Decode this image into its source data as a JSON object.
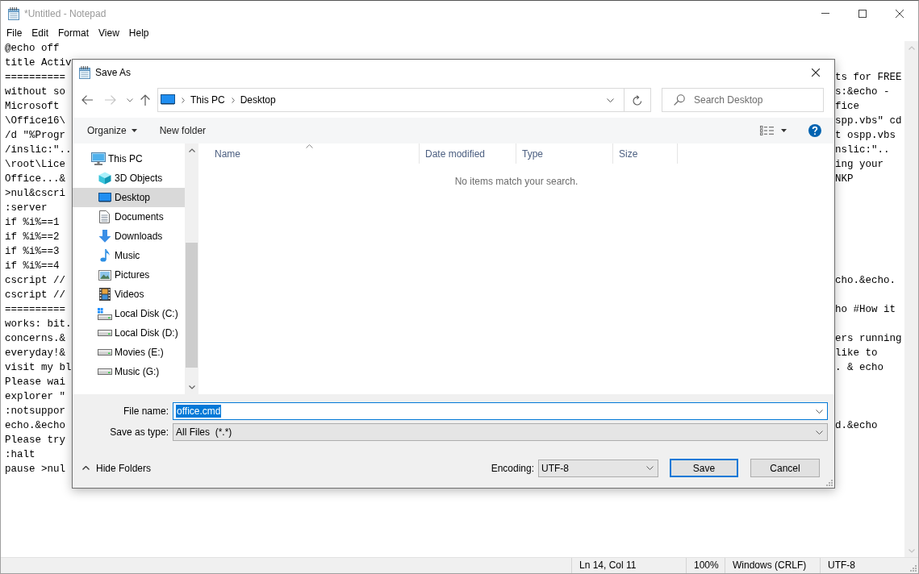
{
  "notepad": {
    "title": "*Untitled - Notepad",
    "menu": [
      "File",
      "Edit",
      "Format",
      "View",
      "Help"
    ],
    "lines": [
      {
        "start": "@echo off"
      },
      {
        "start": "title Activ"
      },
      {
        "start": "==========",
        "end": "ts for FREE"
      },
      {
        "start": "without so",
        "end": "s:&echo -"
      },
      {
        "start": "Microsoft",
        "end": "fice"
      },
      {
        "start": "\\Office16\\",
        "end": "spp.vbs\" cd"
      },
      {
        "start": "/d \"%Progr",
        "end": "t ospp.vbs"
      },
      {
        "start": "/inslic:\"..",
        "end": "nslic:\".."
      },
      {
        "start": "\\root\\Lice",
        "end": "ing your"
      },
      {
        "start": "Office...&",
        "end": "NKP"
      },
      {
        "start": ">nul&cscri"
      },
      {
        "start": ":server"
      },
      {
        "start": "if %i%==1"
      },
      {
        "start": "if %i%==2"
      },
      {
        "start": "if %i%==3"
      },
      {
        "start": "if %i%==4"
      },
      {
        "start": "cscript //",
        "end": "cho.&echo."
      },
      {
        "start": "cscript //"
      },
      {
        "start": "==========",
        "end": "ho #How it"
      },
      {
        "start": "works: bit."
      },
      {
        "start": "concerns.&",
        "end": "ers running"
      },
      {
        "start": "everyday!&",
        "end": "like to"
      },
      {
        "start": "visit my bl",
        "end": ". & echo"
      },
      {
        "start": "Please wai"
      },
      {
        "start": "explorer \""
      },
      {
        "start": ":notsuppor"
      },
      {
        "start": "echo.&echo",
        "end": "d.&echo"
      },
      {
        "start": "Please try"
      },
      {
        "start": ":halt"
      },
      {
        "start": "pause >nul"
      }
    ],
    "status_bar": [
      "Ln 14, Col 11",
      "100%",
      "Windows (CRLF)",
      "UTF-8"
    ]
  },
  "dialog": {
    "title": "Save As",
    "nav": [
      {
        "kind": "back",
        "disabled": false
      },
      {
        "kind": "forward",
        "disabled": true
      },
      {
        "kind": "recent",
        "disabled": false
      },
      {
        "kind": "up",
        "disabled": false
      }
    ],
    "address": [
      "This PC",
      "Desktop"
    ],
    "search": {
      "placeholder": "Search Desktop"
    },
    "toolbar": {
      "organize": "Organize",
      "new_folder": "New folder"
    },
    "sidebar": {
      "items": [
        {
          "label": "This PC",
          "kind": "computer",
          "selected": false,
          "children": [
            {
              "label": "3D Objects",
              "kind": "objects",
              "selected": false
            },
            {
              "label": "Desktop",
              "kind": "desktop",
              "selected": true
            },
            {
              "label": "Documents",
              "kind": "documents",
              "selected": false
            },
            {
              "label": "Downloads",
              "kind": "downloads",
              "selected": false
            },
            {
              "label": "Music",
              "kind": "music",
              "selected": false
            },
            {
              "label": "Pictures",
              "kind": "pictures",
              "selected": false
            },
            {
              "label": "Videos",
              "kind": "videos",
              "selected": false
            },
            {
              "label": "Local Disk (C:)",
              "kind": "system-drive",
              "selected": false
            },
            {
              "label": "Local Disk (D:)",
              "kind": "drive",
              "selected": false
            },
            {
              "label": "Movies (E:)",
              "kind": "drive",
              "selected": false
            },
            {
              "label": "Music (G:)",
              "kind": "drive",
              "selected": false
            }
          ]
        }
      ]
    },
    "columns": [
      {
        "label": "Name",
        "sorted": true
      },
      {
        "label": "Date modified",
        "sorted": false
      },
      {
        "label": "Type",
        "sorted": false
      },
      {
        "label": "Size",
        "sorted": false
      }
    ],
    "empty_message": "No items match your search.",
    "file_name": {
      "label": "File name:",
      "value": "office.cmd",
      "value_selected": true
    },
    "save_as_type": {
      "label": "Save as type:",
      "value": "All Files  (*.*)"
    },
    "hide_folders": "Hide Folders",
    "encoding": {
      "label": "Encoding:",
      "value": "UTF-8"
    },
    "buttons": [
      {
        "label": "Save",
        "default": true
      },
      {
        "label": "Cancel",
        "default": false
      }
    ]
  }
}
